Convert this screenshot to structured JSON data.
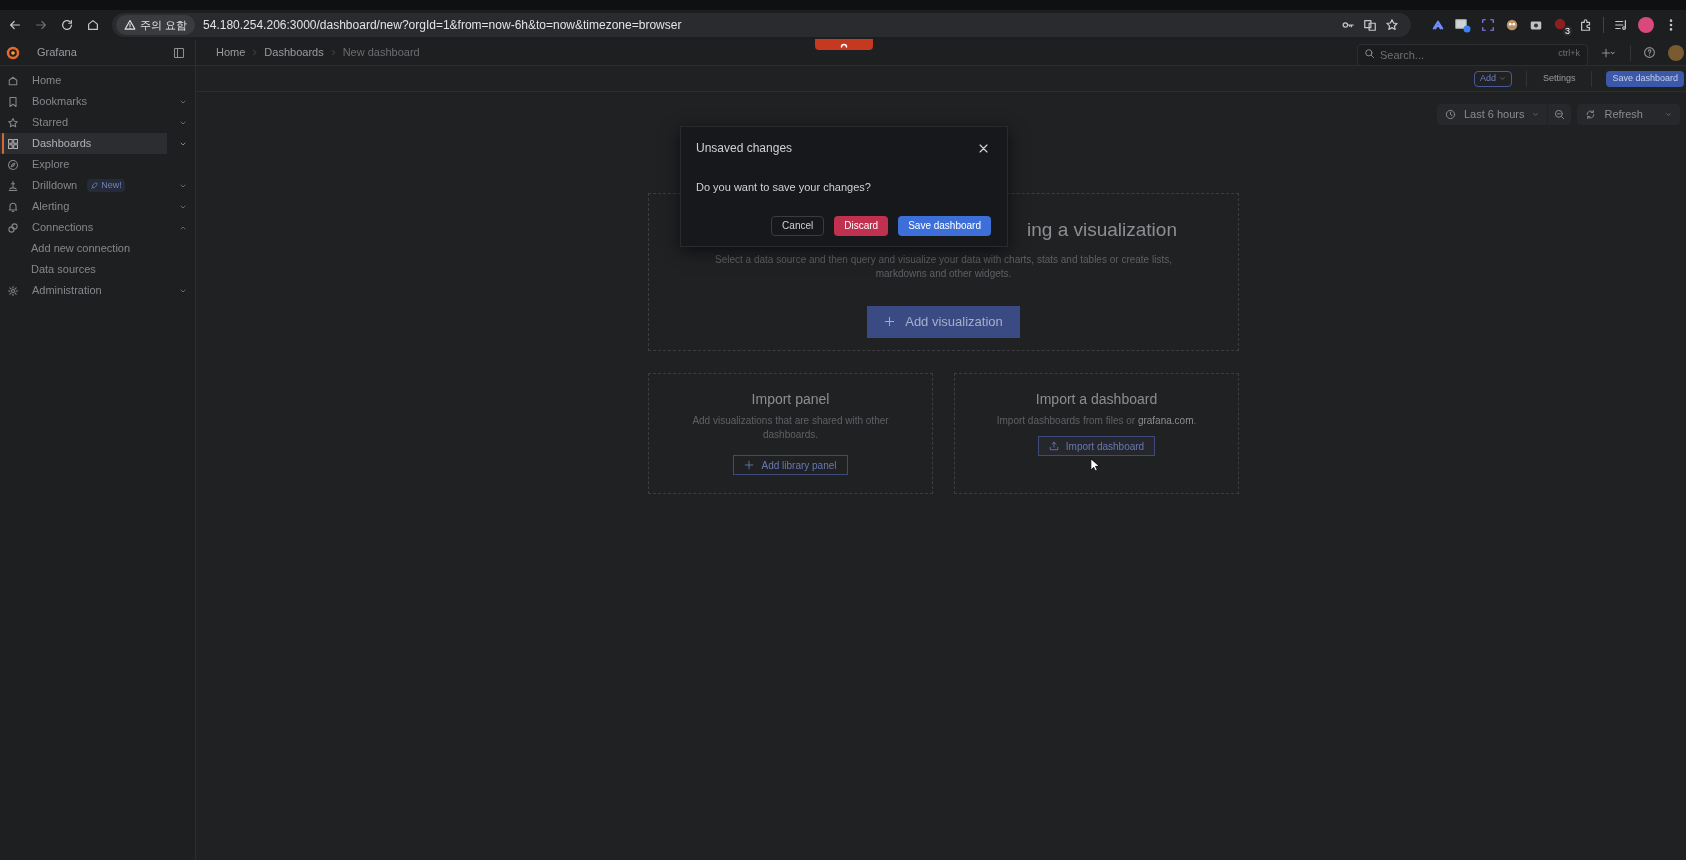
{
  "browser": {
    "warning_label": "주의 요함",
    "url": "54.180.254.206:3000/dashboard/new?orgId=1&from=now-6h&to=now&timezone=browser",
    "extension_badge": "3"
  },
  "header": {
    "brand": "Grafana",
    "breadcrumbs": [
      {
        "label": "Home",
        "current": false
      },
      {
        "label": "Dashboards",
        "current": false
      },
      {
        "label": "New dashboard",
        "current": true
      }
    ],
    "search": {
      "placeholder": "Search...",
      "shortcut": "ctrl+k"
    }
  },
  "sidebar": {
    "items": [
      {
        "label": "Home",
        "kind": "link",
        "selected": false
      },
      {
        "label": "Bookmarks",
        "kind": "group",
        "expanded": false,
        "selected": false
      },
      {
        "label": "Starred",
        "kind": "group",
        "expanded": false,
        "selected": false
      },
      {
        "label": "Dashboards",
        "kind": "group",
        "expanded": false,
        "selected": true
      },
      {
        "label": "Explore",
        "kind": "link",
        "selected": false
      },
      {
        "label": "Drilldown",
        "kind": "group",
        "expanded": false,
        "selected": false,
        "badge": "New!"
      },
      {
        "label": "Alerting",
        "kind": "group",
        "expanded": false,
        "selected": false
      },
      {
        "label": "Connections",
        "kind": "group",
        "expanded": true,
        "selected": false,
        "children": [
          {
            "label": "Add new connection",
            "selected": false
          },
          {
            "label": "Data sources",
            "selected": false
          }
        ]
      },
      {
        "label": "Administration",
        "kind": "group",
        "expanded": false,
        "selected": false
      }
    ]
  },
  "toolbar": {
    "add": "Add",
    "settings": "Settings",
    "save": "Save dashboard"
  },
  "time_controls": {
    "range": "Last 6 hours",
    "refresh": "Refresh"
  },
  "empty_state": {
    "heading": "ing a visualization",
    "description": "Select a data source and then query and visualize your data with charts, stats and tables or create lists, markdowns and other widgets.",
    "button": "Add visualization"
  },
  "cards": [
    {
      "kind": "library",
      "title": "Import panel",
      "description": "Add visualizations that are shared with other dashboards.",
      "button": "Add library panel"
    },
    {
      "kind": "import",
      "title": "Import a dashboard",
      "description": "Import dashboards from files or **grafana.com**.",
      "button": "Import dashboard"
    }
  ],
  "dialog": {
    "title": "Unsaved changes",
    "message": "Do you want to save your changes?",
    "buttons": [
      {
        "label": "Cancel",
        "kind": "secondary"
      },
      {
        "label": "Discard",
        "kind": "destructive"
      },
      {
        "label": "Save dashboard",
        "kind": "primary"
      }
    ]
  }
}
